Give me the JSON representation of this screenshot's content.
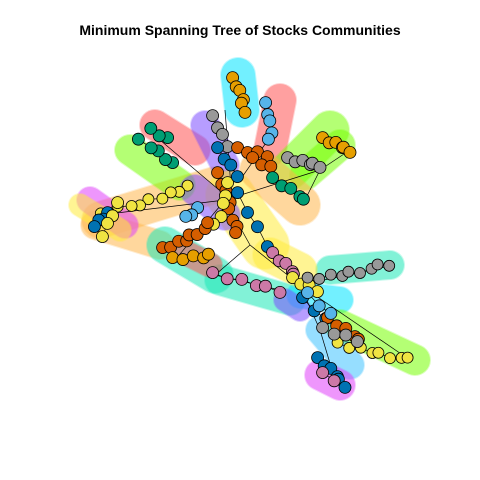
{
  "title": "Minimum Spanning Tree of Stocks Communities",
  "node_colors": {
    "orange": "#E69F00",
    "sky_blue": "#56B4E9",
    "green": "#009E73",
    "yellow": "#F0E442",
    "blue": "#0072B2",
    "vermillion": "#D55E00",
    "pink": "#CC79A7",
    "gray": "#999999"
  },
  "hull_colors": [
    "#FFB74D",
    "#00E5FF",
    "#FF5252",
    "#7C4DFF",
    "#76FF03",
    "#FFEB3B",
    "#1DE9B6",
    "#E040FB",
    "#40C4FF",
    "#B2FF59"
  ],
  "edge_color": "#000000",
  "node_outline": "#000000"
}
